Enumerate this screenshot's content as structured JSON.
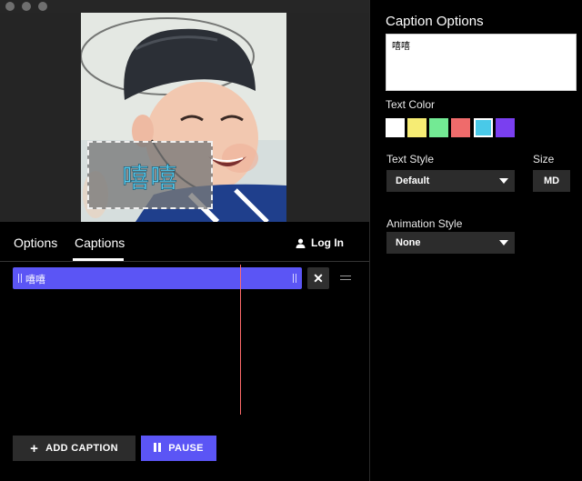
{
  "left": {
    "caption_preview": "嘻嘻",
    "tabs": [
      {
        "label": "Options"
      },
      {
        "label": "Captions"
      }
    ],
    "login_label": "Log In",
    "timeline": {
      "caption_label": "嘻嘻"
    },
    "add_caption_label": "ADD CAPTION",
    "pause_label": "PAUSE"
  },
  "right": {
    "title": "Caption Options",
    "caption_text": "嘻嘻",
    "text_color_label": "Text Color",
    "colors": [
      "#ffffff",
      "#f6ec74",
      "#73ea94",
      "#ef6b6b",
      "#49c9e8",
      "#7a3ff0"
    ],
    "text_style_label": "Text Style",
    "text_style_value": "Default",
    "size_label": "Size",
    "size_value": "MD",
    "animation_label": "Animation Style",
    "animation_value": "None"
  },
  "accent": "#5b55f5",
  "playhead_color": "#ff6b6b"
}
